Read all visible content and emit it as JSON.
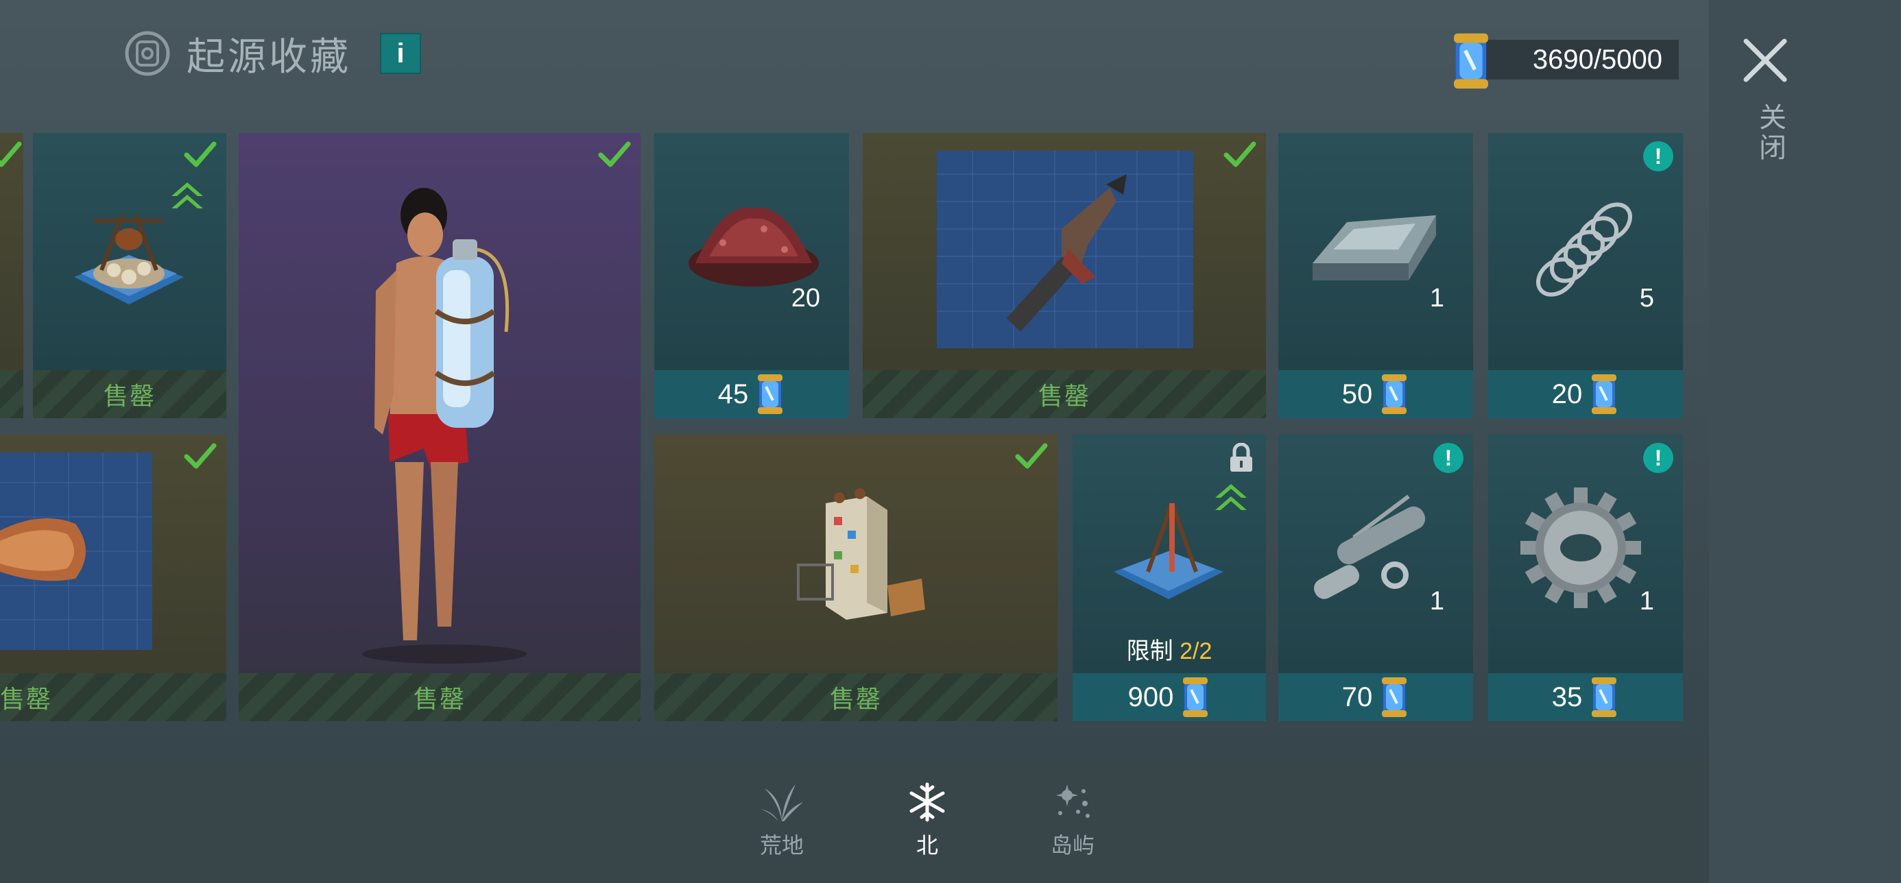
{
  "header": {
    "title": "起源收藏",
    "info_label": "i",
    "currency": "3690/5000",
    "close_label": "关闭"
  },
  "cards": {
    "c1": {
      "status": "售罄"
    },
    "c2": {
      "status": "售罄"
    },
    "c3": {
      "status": "售罄"
    },
    "c4": {
      "qty": "20",
      "price": "45"
    },
    "c5": {
      "status": "售罄"
    },
    "c6": {
      "qty": "1",
      "price": "50"
    },
    "c7": {
      "qty": "5",
      "price": "20"
    },
    "c8": {
      "status": "售罄"
    },
    "c9": {
      "limit_label": "限制",
      "limit_value": "2/2",
      "price": "900"
    },
    "c10": {
      "qty": "1",
      "price": "70"
    },
    "c11": {
      "qty": "1",
      "price": "35"
    }
  },
  "nav": {
    "items": [
      {
        "label": "荒地",
        "icon": "grass-icon",
        "active": false
      },
      {
        "label": "北",
        "icon": "snowflake-icon",
        "active": true
      },
      {
        "label": "岛屿",
        "icon": "island-icon",
        "active": false
      }
    ]
  },
  "colors": {
    "price_bar": "#1d5c66",
    "sold_text": "#6fb35d",
    "limit_value": "#f5c542",
    "check": "#58c046"
  }
}
